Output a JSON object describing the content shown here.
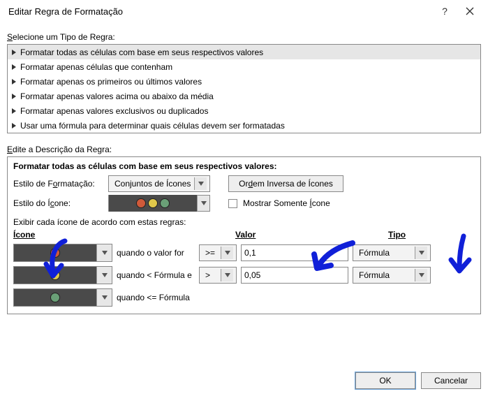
{
  "titlebar": {
    "title": "Editar Regra de Formatação"
  },
  "section_rule_type_label": "Selecione um Tipo de Regra:",
  "rule_types": {
    "r0": "Formatar todas as células com base em seus respectivos valores",
    "r1": "Formatar apenas células que contenham",
    "r2": "Formatar apenas os primeiros ou últimos valores",
    "r3": "Formatar apenas valores acima ou abaixo da média",
    "r4": "Formatar apenas valores exclusivos ou duplicados",
    "r5": "Usar uma fórmula para determinar quais células devem ser formatadas"
  },
  "edit_label": "Edite a Descrição da Regra:",
  "desc_title": "Formatar todas as células com base em seus respectivos valores:",
  "format_style_label": "Estilo de Formatação:",
  "format_style_value": "Conjuntos de Ícones",
  "reverse_btn": "Ordem Inversa de Ícones",
  "icon_style_label": "Estilo do Ícone:",
  "show_icon_only": "Mostrar Somente Ícone",
  "rules_title": "Exibir cada ícone de acordo com estas regras:",
  "hdr_icon": "Ícone",
  "hdr_valor": "Valor",
  "hdr_tipo": "Tipo",
  "rule1": {
    "cond": "quando o valor for",
    "op": ">=",
    "val": "0,1",
    "tipo": "Fórmula"
  },
  "rule2": {
    "cond": "quando < Fórmula e",
    "op": ">",
    "val": "0,05",
    "tipo": "Fórmula"
  },
  "rule3": {
    "cond": "quando <= Fórmula"
  },
  "colors": {
    "red": "#d05a3a",
    "yellow": "#e0c84a",
    "green": "#6aa077"
  },
  "buttons": {
    "ok": "OK",
    "cancel": "Cancelar"
  }
}
